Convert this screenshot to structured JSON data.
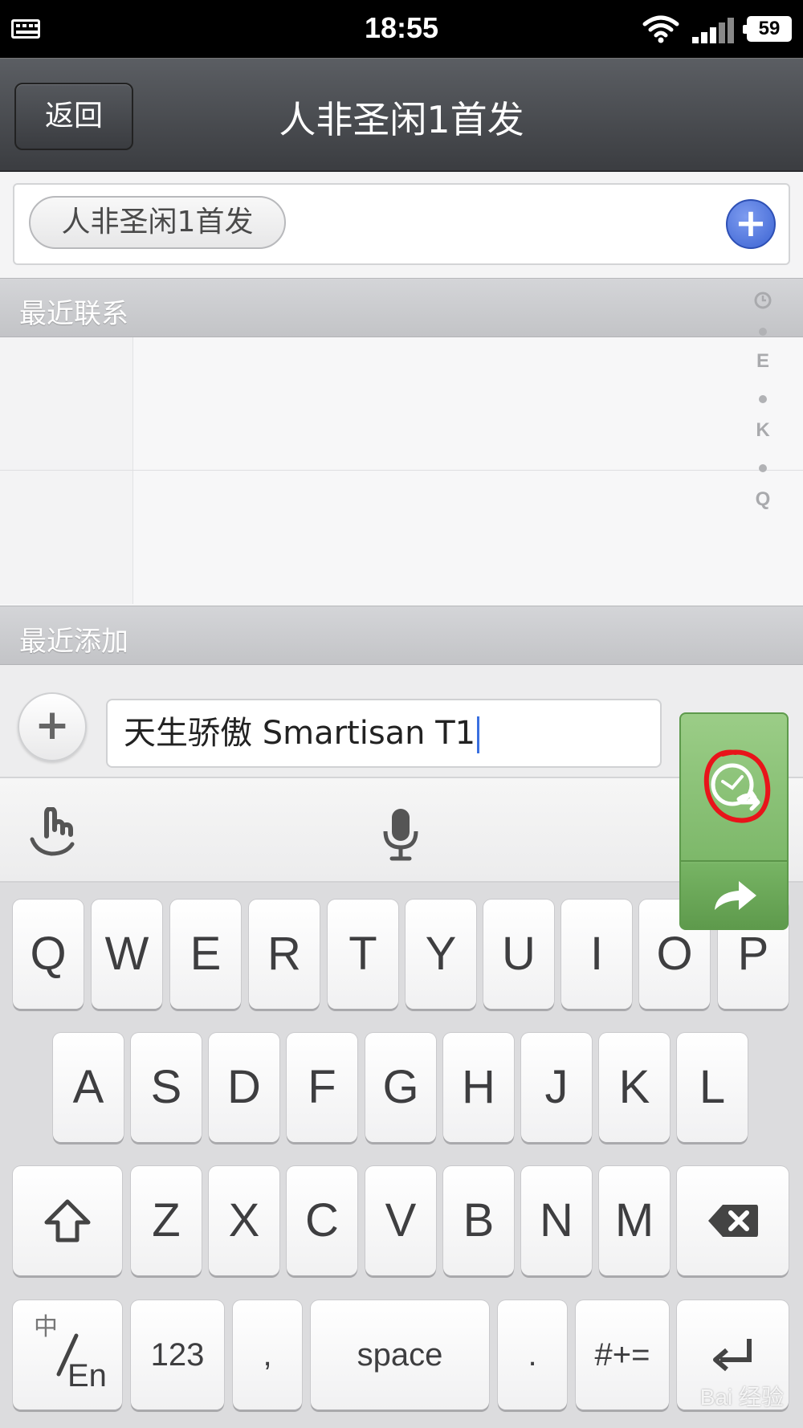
{
  "status_bar": {
    "time": "18:55",
    "battery": "59"
  },
  "nav": {
    "back_label": "返回",
    "title": "人非圣闲1首发"
  },
  "recipients": {
    "chip": "人非圣闲1首发"
  },
  "sections": {
    "recent_contacts": "最近联系",
    "recent_added": "最近添加"
  },
  "index_bar": [
    "E",
    "K",
    "Q"
  ],
  "compose": {
    "message": "天生骄傲 Smartisan T1"
  },
  "icons": {
    "keyboard_status": "keyboard-icon",
    "wifi": "wifi-icon",
    "signal": "signal-icon",
    "add_recipient": "plus-circle-icon",
    "attach": "plus-icon",
    "schedule": "clock-forward-icon",
    "send": "arrow-right-icon",
    "handwriting": "hand-gesture-icon",
    "voice": "microphone-icon",
    "hide_keyboard": "arrow-down-icon",
    "shift": "shift-arrow-icon",
    "backspace": "backspace-icon"
  },
  "keyboard": {
    "row1": [
      "Q",
      "W",
      "E",
      "R",
      "T",
      "Y",
      "U",
      "I",
      "O",
      "P"
    ],
    "row2": [
      "A",
      "S",
      "D",
      "F",
      "G",
      "H",
      "J",
      "K",
      "L"
    ],
    "row3": [
      "Z",
      "X",
      "C",
      "V",
      "B",
      "N",
      "M"
    ],
    "lang_top": "中",
    "lang_bottom": "En",
    "numbers": "123",
    "comma": ",",
    "space": "space",
    "period": ".",
    "symbols": "#+="
  },
  "colors": {
    "send_green": "#6fae5c",
    "add_blue": "#3b63d2",
    "annotation_red": "#e8141a",
    "caret_blue": "#3a70e0"
  },
  "watermark": "Bai 经验"
}
